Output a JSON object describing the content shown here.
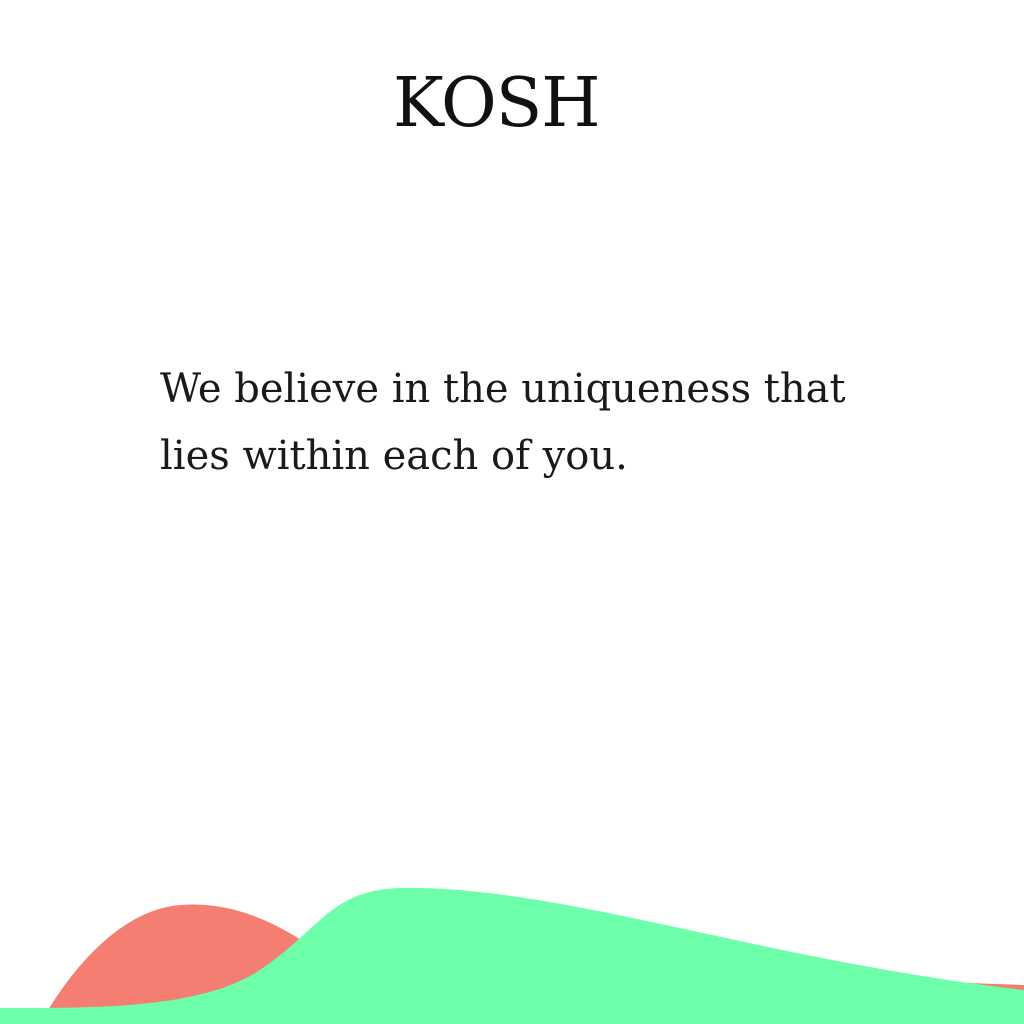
{
  "brand": {
    "logo_text": "KOSH"
  },
  "tagline": {
    "text": "We believe in the uniqueness that lies within each of you."
  },
  "colors": {
    "background": "#ffffff",
    "text": "#111111",
    "wave_coral": "#f57e72",
    "wave_mint": "#6effaa"
  }
}
